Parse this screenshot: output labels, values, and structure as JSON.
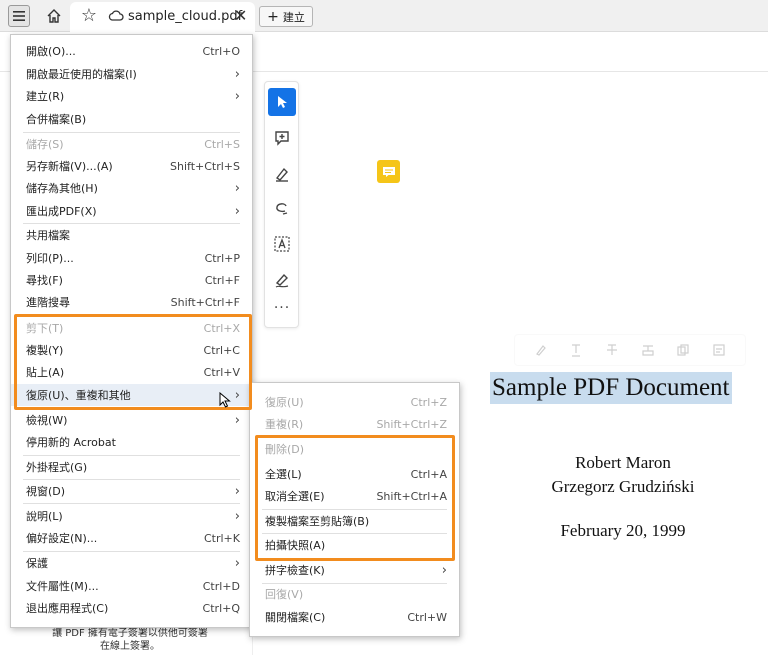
{
  "tab": {
    "title": "sample_cloud.pdf",
    "close": "✕",
    "new_tab_label": "建立"
  },
  "menu": {
    "items": [
      {
        "label": "開啟(O)...",
        "shortcut": "Ctrl+O"
      },
      {
        "label": "開啟最近使用的檔案(I)",
        "submenu": true
      },
      {
        "label": "建立(R)",
        "submenu": true
      },
      {
        "label": "合併檔案(B)"
      },
      {
        "label": "儲存(S)",
        "shortcut": "Ctrl+S",
        "disabled": true
      },
      {
        "label": "另存新檔(V)...(A)",
        "shortcut": "Shift+Ctrl+S"
      },
      {
        "label": "儲存為其他(H)",
        "submenu": true
      },
      {
        "label": "匯出成PDF(X)",
        "submenu": true
      },
      {
        "label": "共用檔案"
      },
      {
        "label": "列印(P)...",
        "shortcut": "Ctrl+P"
      },
      {
        "label": "尋找(F)",
        "shortcut": "Ctrl+F"
      },
      {
        "label": "進階搜尋",
        "shortcut": "Shift+Ctrl+F"
      },
      {
        "label": "剪下(T)",
        "shortcut": "Ctrl+X",
        "disabled": true
      },
      {
        "label": "複製(Y)",
        "shortcut": "Ctrl+C"
      },
      {
        "label": "貼上(A)",
        "shortcut": "Ctrl+V"
      },
      {
        "label": "復原(U)、重複和其他",
        "submenu": true
      },
      {
        "label": "檢視(W)",
        "submenu": true
      },
      {
        "label": "停用新的 Acrobat"
      },
      {
        "label": "外掛程式(G)"
      },
      {
        "label": "視窗(D)",
        "submenu": true
      },
      {
        "label": "說明(L)",
        "submenu": true
      },
      {
        "label": "偏好設定(N)...",
        "shortcut": "Ctrl+K"
      },
      {
        "label": "保護",
        "submenu": true
      },
      {
        "label": "文件屬性(M)...",
        "shortcut": "Ctrl+D"
      },
      {
        "label": "退出應用程式(C)",
        "shortcut": "Ctrl+Q"
      }
    ]
  },
  "submenu": {
    "items": [
      {
        "label": "復原(U)",
        "shortcut": "Ctrl+Z",
        "disabled": true
      },
      {
        "label": "重複(R)",
        "shortcut": "Shift+Ctrl+Z",
        "disabled": true
      },
      {
        "label": "刪除(D)",
        "disabled": true
      },
      {
        "label": "全選(L)",
        "shortcut": "Ctrl+A"
      },
      {
        "label": "取消全選(E)",
        "shortcut": "Shift+Ctrl+A"
      },
      {
        "label": "複製檔案至剪貼簿(B)"
      },
      {
        "label": "拍攝快照(A)"
      },
      {
        "label": "拼字檢查(K)",
        "submenu": true
      },
      {
        "label": "回復(V)",
        "disabled": true
      },
      {
        "label": "關閉檔案(C)",
        "shortcut": "Ctrl+W"
      }
    ]
  },
  "document": {
    "title": "Sample PDF Document",
    "authors": [
      "Robert Maron",
      "Grzegorz Grudziński"
    ],
    "date": "February 20, 1999"
  },
  "footer_note": [
    "讓 PDF 擁有電子簽署以供他可簽署",
    "在線上簽署。"
  ],
  "tools_more": "···",
  "colors": {
    "accent": "#1473e6",
    "highlight_border": "#f28c1e",
    "selection": "#c8dcee",
    "sticky_note": "#f5c518"
  }
}
